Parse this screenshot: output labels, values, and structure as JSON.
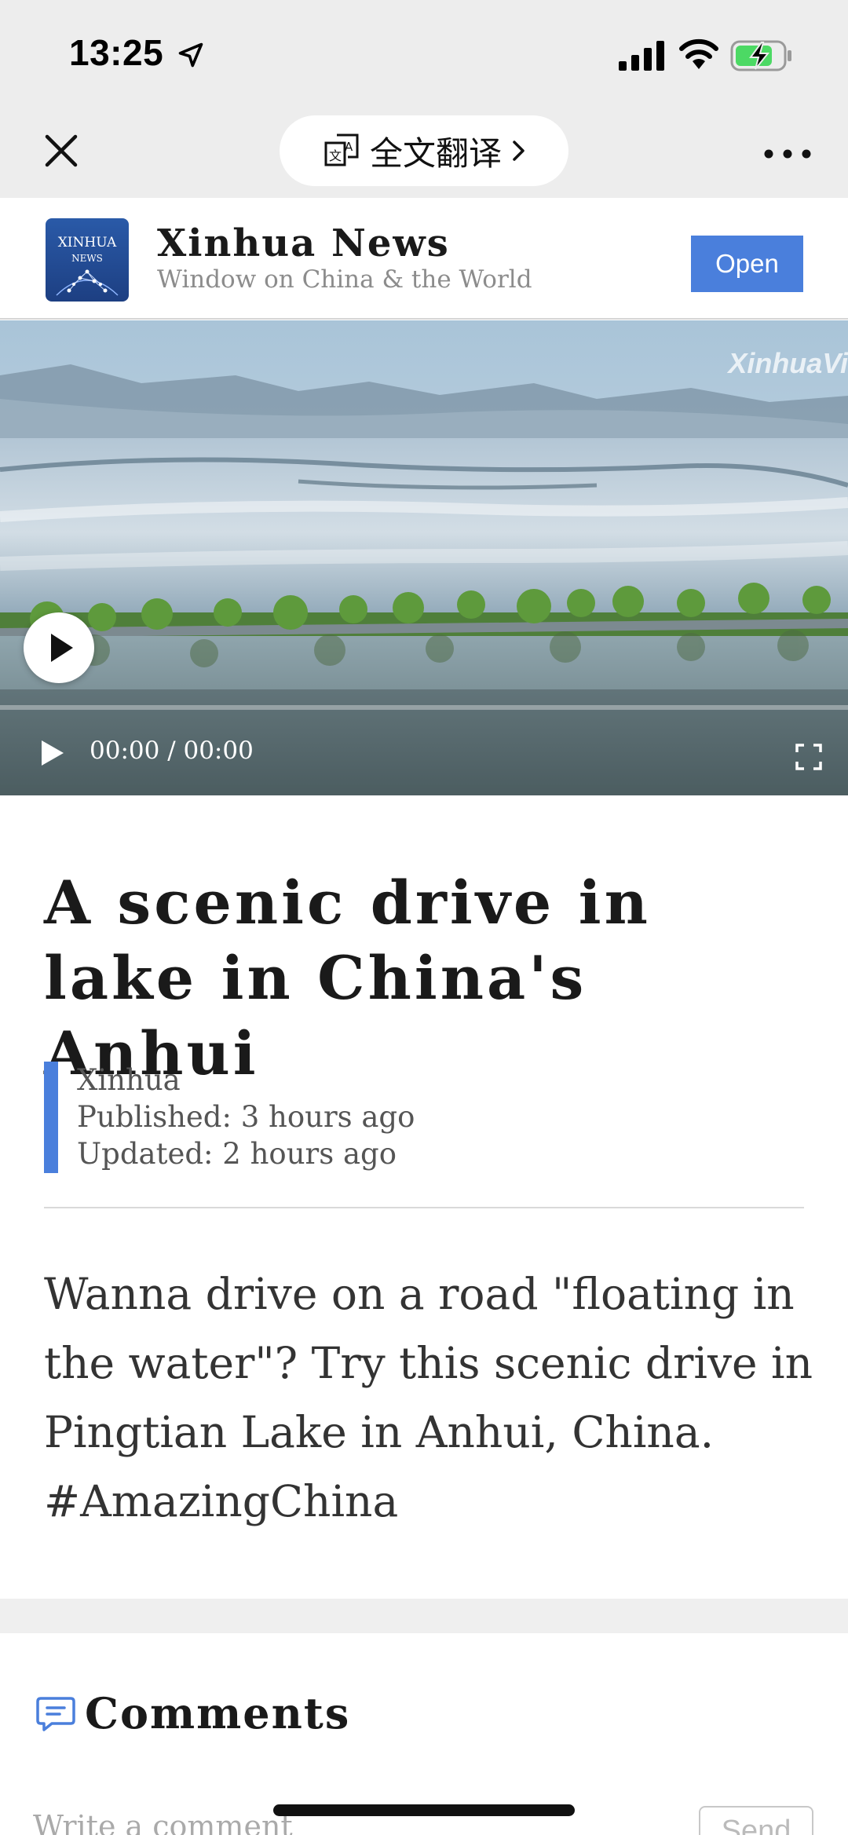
{
  "status_bar": {
    "time": "13:25",
    "icons": [
      "location-arrow-icon",
      "cellular-signal-icon",
      "wifi-icon",
      "battery-charging-icon"
    ]
  },
  "nav": {
    "close_icon": "close-icon",
    "translate_label": "全文翻译",
    "translate_icon": "translate-icon",
    "more_icon": "more-dots-icon"
  },
  "publisher": {
    "logo_text_line1": "XINHUA",
    "logo_text_line2": "NEWS",
    "name": "Xinhua News",
    "tagline": "Window on China & the World",
    "open_label": "Open",
    "accent_color": "#4a7fdc"
  },
  "video": {
    "watermark": "XinhuaVi",
    "time_display": "00:00 / 00:00",
    "progress": 0
  },
  "article": {
    "title": "A scenic drive in lake in China's Anhui",
    "source": "Xinhua",
    "published": "Published: 3 hours ago",
    "updated": "Updated: 2 hours ago",
    "body": "Wanna drive on a road \"floating in the water\"? Try this scenic drive in Pingtian Lake in Anhui, China. #AmazingChina"
  },
  "comments": {
    "heading": "Comments",
    "input_placeholder": "Write a comment",
    "send_label": "Send"
  }
}
